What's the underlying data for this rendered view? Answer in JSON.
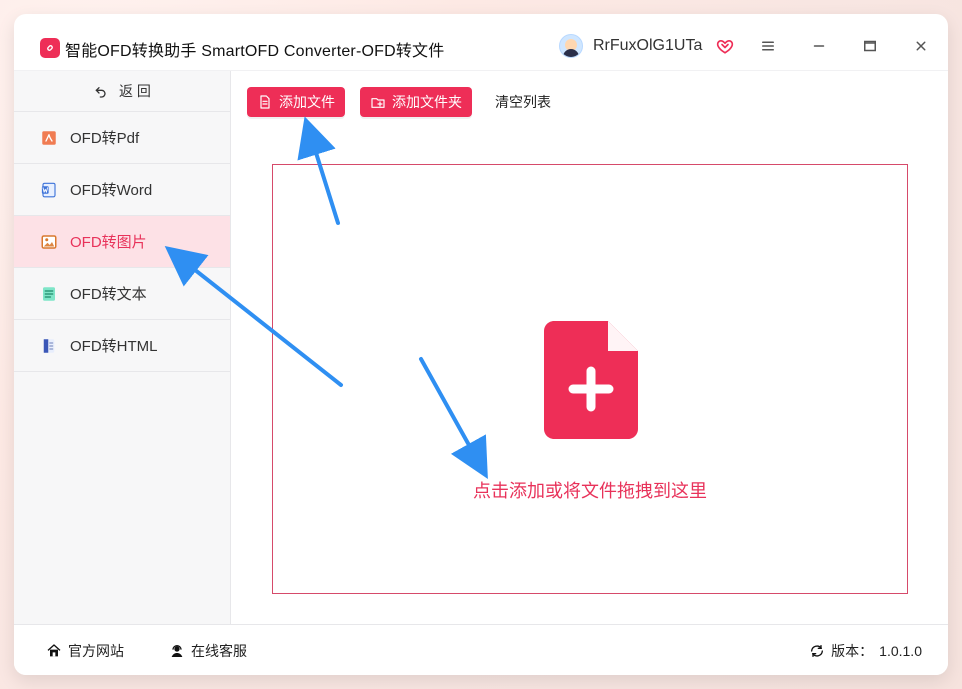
{
  "colors": {
    "accent": "#ee2e57",
    "accent_text": "#e8325a",
    "sidebar_selected_bg": "#fde1e6",
    "annotation_blue": "#2f8ff2"
  },
  "titlebar": {
    "app_title": "智能OFD转换助手 SmartOFD Converter-OFD转文件",
    "username": "RrFuxOlG1UTa"
  },
  "sidebar": {
    "back_label": "返  回",
    "items": [
      {
        "label": "OFD转Pdf",
        "icon": "pdf-icon"
      },
      {
        "label": "OFD转Word",
        "icon": "word-icon"
      },
      {
        "label": "OFD转图片",
        "icon": "image-icon"
      },
      {
        "label": "OFD转文本",
        "icon": "text-icon"
      },
      {
        "label": "OFD转HTML",
        "icon": "html-icon"
      }
    ],
    "selected_index": 2
  },
  "toolbar": {
    "add_file": "添加文件",
    "add_folder": "添加文件夹",
    "clear_list": "清空列表"
  },
  "dropzone": {
    "hint": "点击添加或将文件拖拽到这里"
  },
  "footer": {
    "website": "官方网站",
    "service": "在线客服",
    "version_prefix": "版本：",
    "version": "1.0.1.0"
  }
}
